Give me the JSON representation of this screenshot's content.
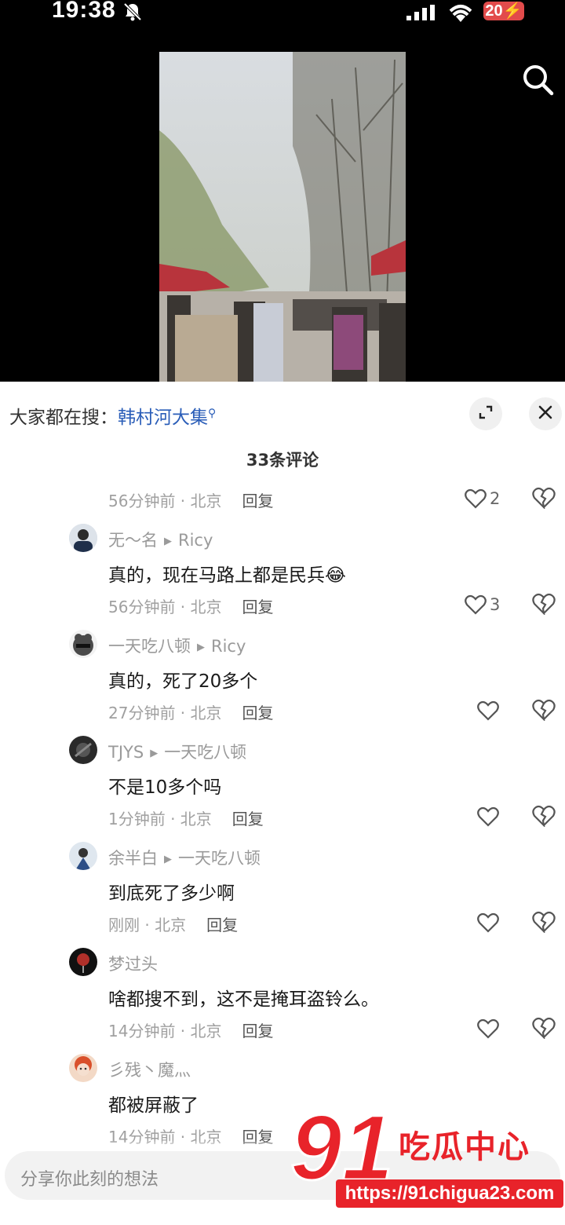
{
  "status_bar": {
    "time": "19:38",
    "battery": "20"
  },
  "trending": {
    "prefix": "大家都在搜：",
    "term": "韩村河大集"
  },
  "comments_count_label": "33条评论",
  "comments": [
    {
      "name": "",
      "reply_to": "",
      "text": "",
      "time": "56分钟前 · 北京",
      "reply": "回复",
      "likes": "2"
    },
    {
      "name": "无～名",
      "reply_to": "Ricy",
      "text": "真的，现在马路上都是民兵",
      "emoji": "😂",
      "time": "56分钟前 · 北京",
      "reply": "回复",
      "likes": "3"
    },
    {
      "name": "一天吃八顿",
      "reply_to": "Ricy",
      "text": "真的，死了20多个",
      "time": "27分钟前 · 北京",
      "reply": "回复",
      "likes": ""
    },
    {
      "name": "TJYS",
      "reply_to": "一天吃八顿",
      "text": "不是10多个吗",
      "time": "1分钟前 · 北京",
      "reply": "回复",
      "likes": ""
    },
    {
      "name": "余半白",
      "reply_to": "一天吃八顿",
      "text": "到底死了多少啊",
      "time": "刚刚 · 北京",
      "reply": "回复",
      "likes": ""
    },
    {
      "name": "梦过头",
      "reply_to": "",
      "text": "啥都搜不到，这不是掩耳盗铃么。",
      "time": "14分钟前 · 北京",
      "reply": "回复",
      "likes": ""
    },
    {
      "name": "彡残丶魔灬",
      "reply_to": "",
      "text": "都被屏蔽了",
      "time": "14分钟前 · 北京",
      "reply": "回复",
      "likes": ""
    }
  ],
  "input": {
    "placeholder": "分享你此刻的想法"
  },
  "watermark": {
    "number": "91",
    "title": "吃瓜中心",
    "url": "https://91chigua23.com"
  },
  "colors": {
    "link": "#2a5db8",
    "watermark": "#e8232a",
    "battery": "#e24b4b"
  }
}
